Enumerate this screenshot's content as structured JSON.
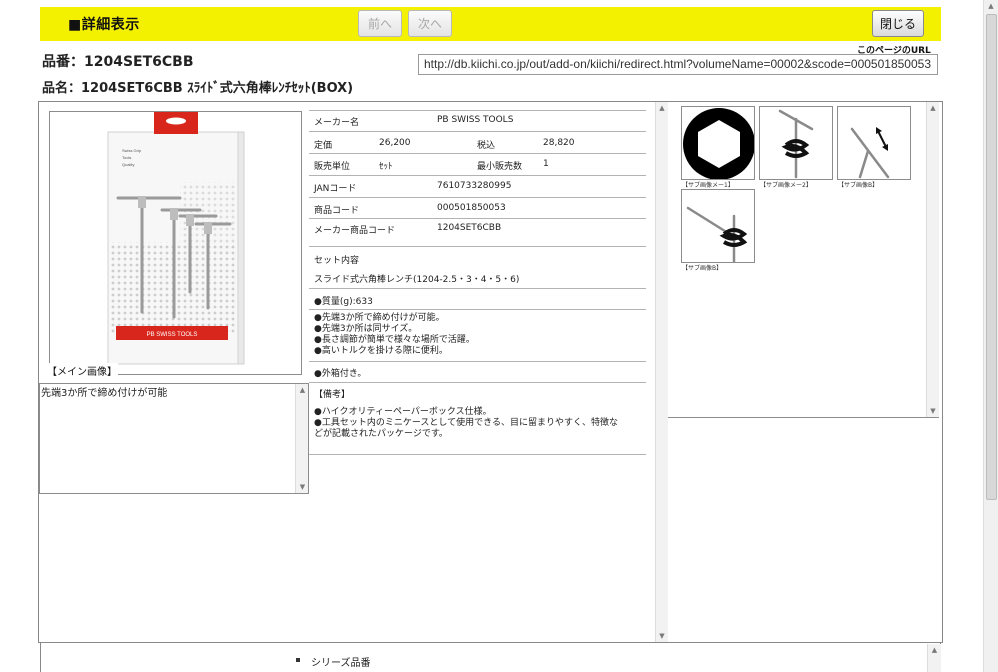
{
  "header": {
    "title": "■詳細表示",
    "prev_label": "前へ",
    "next_label": "次へ",
    "close_label": "閉じる"
  },
  "product": {
    "number_line": "品番：1204SET6CBB",
    "name_line": "品名：1204SET6CBB ｽﾗｲﾄﾞ式六角棒ﾚﾝﾁｾｯﾄ(BOX)"
  },
  "page_url": {
    "caption": "このページのURL",
    "value": "http://db.kiichi.co.jp/out/add-on/kiichi/redirect.html?volumeName=00002&scode=000501850053"
  },
  "main_image": {
    "caption": "【メイン画像】",
    "package_brand": "PB SWISS TOOLS",
    "package_lines": [
      "Swiss Grip",
      "Tools",
      "Quality"
    ],
    "accent_color": "#d9261c"
  },
  "note_box": {
    "text": "先端3か所で締め付けが可能"
  },
  "specs": {
    "maker_label": "メーカー名",
    "maker_value": "PB SWISS TOOLS",
    "list_price_label": "定価",
    "list_price_value": "26,200",
    "tax_incl_label": "税込",
    "tax_incl_value": "28,820",
    "sales_unit_label": "販売単位",
    "sales_unit_value": "ｾｯﾄ",
    "min_qty_label": "最小販売数",
    "min_qty_value": "1",
    "jan_label": "JANコード",
    "jan_value": "7610733280995",
    "product_code_label": "商品コード",
    "product_code_value": "000501850053",
    "maker_code_label": "メーカー商品コード",
    "maker_code_value": "1204SET6CBB",
    "set_contents_label": "セット内容",
    "set_contents_value": "スライド式六角棒レンチ(1204-2.5・3・4・5・6)",
    "weight": "●質量(g):633",
    "features": [
      "●先端3か所で締め付けが可能。",
      "●先端3か所は同サイズ。",
      "●長さ調節が簡単で様々な場所で活躍。",
      "●高いトルクを掛ける際に便利。"
    ],
    "outer_box": "●外箱付き。",
    "remarks_label": "【備考】",
    "remarks": [
      "●ハイクオリティーペーパーボックス仕様。",
      "●工具セット内のミニケースとして使用できる、目に留まりやすく、特徴な",
      "どが記載されたパッケージです。"
    ]
  },
  "thumbnails": [
    {
      "label": "【サブ画像メー1】",
      "icon": "hexagon-icon"
    },
    {
      "label": "【サブ画像メー2】",
      "icon": "wrench-rotate-icon"
    },
    {
      "label": "【サブ画像B】",
      "icon": "wrench-slide-icon"
    },
    {
      "label": "【サブ画像B】",
      "icon": "wrench-rotate-icon"
    }
  ],
  "bottom": {
    "series_label": "シリーズ品番"
  }
}
